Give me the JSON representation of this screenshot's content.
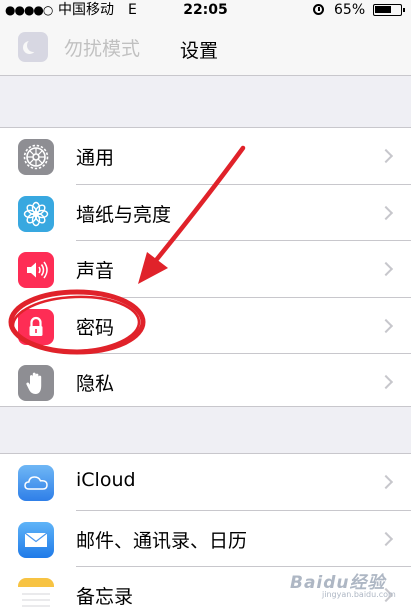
{
  "status_bar": {
    "signal_dots": "●●●●○",
    "carrier": "中国移动",
    "network": "E",
    "time": "22:05",
    "battery_percent": "65%",
    "battery_level": 0.65
  },
  "nav_bar": {
    "title": "设置",
    "background_item": "勿扰模式"
  },
  "sections": [
    {
      "items": [
        {
          "label": "通用",
          "icon": "gear-icon",
          "color": "#8e8e93"
        },
        {
          "label": "墙纸与亮度",
          "icon": "flower-icon",
          "color": "#38a8e0"
        },
        {
          "label": "声音",
          "icon": "speaker-icon",
          "color": "#fe2d55"
        },
        {
          "label": "密码",
          "icon": "lock-icon",
          "color": "#fe2d55"
        },
        {
          "label": "隐私",
          "icon": "hand-icon",
          "color": "#8e8e93"
        }
      ]
    },
    {
      "items": [
        {
          "label": "iCloud",
          "icon": "cloud-icon",
          "color": "#3a8ef0"
        },
        {
          "label": "邮件、通讯录、日历",
          "icon": "mail-icon",
          "color": "#3a8ef0"
        },
        {
          "label": "备忘录",
          "icon": "notes-icon",
          "color": "#f7c343"
        }
      ]
    }
  ],
  "colors": {
    "annotation": "#e0222a"
  },
  "watermark": {
    "brand": "Baidu经验",
    "url": "jingyan.baidu.com"
  }
}
